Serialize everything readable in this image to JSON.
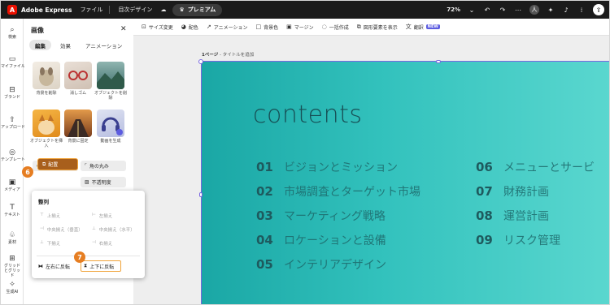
{
  "topbar": {
    "app_name": "Adobe Express",
    "logo_letter": "A",
    "file_menu": "ファイル",
    "doc_title": "目次デザイン",
    "premium": "プレミアム",
    "zoom": "72%",
    "avatar_letter": "人"
  },
  "rail": {
    "items": [
      {
        "label": "検索",
        "icon": "search-icon"
      },
      {
        "label": "マイファイル",
        "icon": "folder-icon"
      },
      {
        "label": "ブランド",
        "icon": "brand-icon"
      },
      {
        "label": "アップロード",
        "icon": "upload-icon"
      },
      {
        "label": "テンプレート",
        "icon": "template-icon"
      },
      {
        "label": "メディア",
        "icon": "media-icon"
      },
      {
        "label": "テキスト",
        "icon": "text-icon"
      },
      {
        "label": "素材",
        "icon": "elements-icon"
      },
      {
        "label": "グリッドとグリッド",
        "icon": "grid-icon"
      },
      {
        "label": "生成AI",
        "icon": "ai-icon"
      }
    ]
  },
  "panel": {
    "title": "画像",
    "tabs": [
      "編集",
      "効果",
      "アニメーション"
    ],
    "tiles": [
      {
        "label": "背景を削除"
      },
      {
        "label": "消しゴム"
      },
      {
        "label": "オブジェクトを削除"
      },
      {
        "label": "オブジェクトを挿入"
      },
      {
        "label": "背景に固定"
      },
      {
        "label": "動画を生成"
      }
    ],
    "buttons": {
      "adjust": "調整",
      "rounded": "角の丸み",
      "arrange": "配置",
      "opacity": "不透明度"
    }
  },
  "popup": {
    "title": "整列",
    "align": {
      "top": "上揃え",
      "left": "左揃え",
      "middle_v": "中央揃え（垂直）",
      "center_h": "中央揃え（水平）",
      "bottom": "下揃え",
      "right": "右揃え"
    },
    "flip_h": "左右に反転",
    "flip_v": "上下に反転"
  },
  "markers": {
    "m6": "6",
    "m7": "7"
  },
  "canvas_toolbar": {
    "items": [
      "サイズ変更",
      "配色",
      "アニメーション",
      "背景色",
      "マージン",
      "一括作成",
      "図形要素を表示",
      "翻訳"
    ],
    "new_badge": "NEW"
  },
  "page": {
    "label_bold": "1ページ",
    "label_rest": " - タイトルを追加"
  },
  "slide": {
    "title": "contents",
    "toc_left": [
      {
        "num": "01",
        "text": "ビジョンとミッション"
      },
      {
        "num": "02",
        "text": "市場調査とターゲット市場"
      },
      {
        "num": "03",
        "text": "マーケティング戦略"
      },
      {
        "num": "04",
        "text": "ロケーションと設備"
      },
      {
        "num": "05",
        "text": "インテリアデザイン"
      }
    ],
    "toc_right": [
      {
        "num": "06",
        "text": "メニューとサービ"
      },
      {
        "num": "07",
        "text": "財務計画"
      },
      {
        "num": "08",
        "text": "運営計画"
      },
      {
        "num": "09",
        "text": "リスク管理"
      }
    ]
  },
  "colors": {
    "accent_orange": "#e67e22",
    "selection_purple": "#7a67e0",
    "slide_teal": "#33c2bd"
  }
}
